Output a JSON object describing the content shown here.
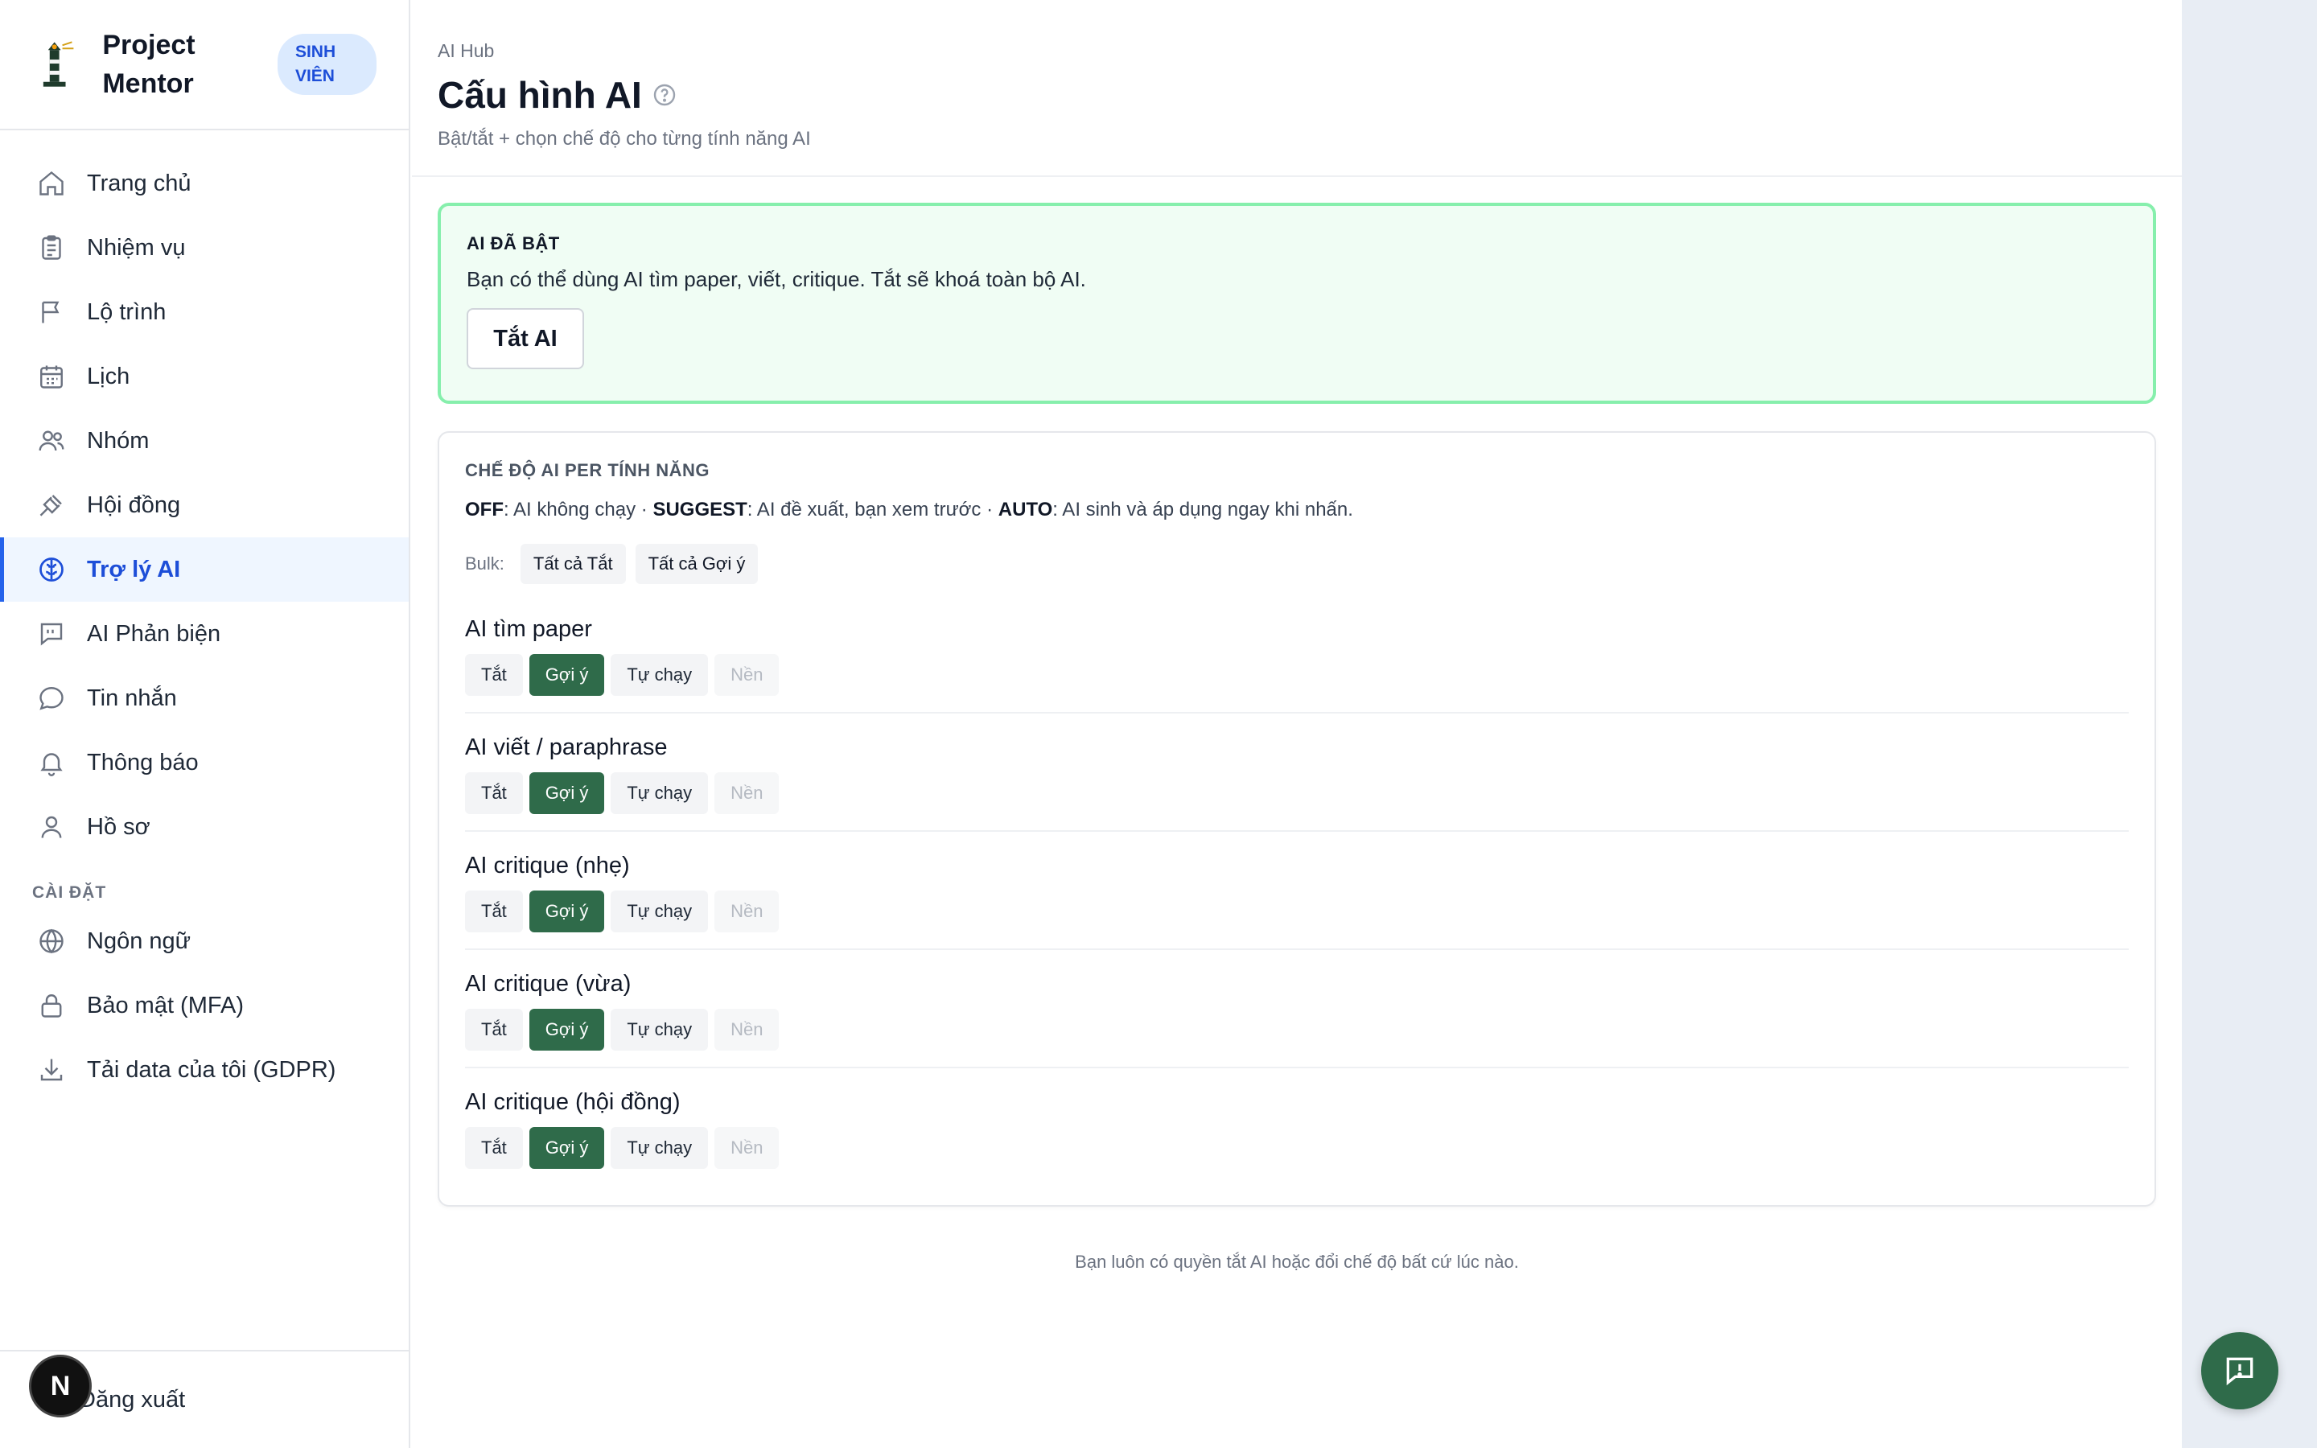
{
  "app": {
    "name": "Project Mentor",
    "role_badge": "SINH VIÊN"
  },
  "sidebar": {
    "items": [
      {
        "label": "Trang chủ",
        "icon": "home-icon"
      },
      {
        "label": "Nhiệm vụ",
        "icon": "clipboard-icon"
      },
      {
        "label": "Lộ trình",
        "icon": "flag-icon"
      },
      {
        "label": "Lịch",
        "icon": "calendar-icon"
      },
      {
        "label": "Nhóm",
        "icon": "users-icon"
      },
      {
        "label": "Hội đồng",
        "icon": "gavel-icon"
      },
      {
        "label": "Trợ lý AI",
        "icon": "brain-icon",
        "active": true
      },
      {
        "label": "AI Phản biện",
        "icon": "quote-message-icon"
      },
      {
        "label": "Tin nhắn",
        "icon": "chat-bubble-icon"
      },
      {
        "label": "Thông báo",
        "icon": "bell-icon"
      },
      {
        "label": "Hồ sơ",
        "icon": "user-icon"
      }
    ],
    "settings_label": "CÀI ĐẶT",
    "settings_items": [
      {
        "label": "Ngôn ngữ",
        "icon": "globe-icon"
      },
      {
        "label": "Bảo mật (MFA)",
        "icon": "lock-icon"
      },
      {
        "label": "Tải data của tôi (GDPR)",
        "icon": "download-icon"
      }
    ],
    "logout_label": "Đăng xuất",
    "avatar_initial": "N"
  },
  "header": {
    "breadcrumb": "AI Hub",
    "title": "Cấu hình AI",
    "subtitle": "Bật/tắt + chọn chế độ cho từng tính năng AI"
  },
  "status_card": {
    "heading": "AI ĐÃ BẬT",
    "text": "Bạn có thể dùng AI tìm paper, viết, critique. Tắt sẽ khoá toàn bộ AI.",
    "button": "Tắt AI"
  },
  "modes_card": {
    "heading": "CHẾ ĐỘ AI PER TÍNH NĂNG",
    "legend": {
      "off_key": "OFF",
      "off_desc": ": AI không chạy · ",
      "suggest_key": "SUGGEST",
      "suggest_desc": ": AI đề xuất, bạn xem trước · ",
      "auto_key": "AUTO",
      "auto_desc": ": AI sinh và áp dụng ngay khi nhấn."
    },
    "bulk_label": "Bulk:",
    "bulk_buttons": [
      "Tất cả Tắt",
      "Tất cả Gợi ý"
    ],
    "mode_labels": [
      "Tắt",
      "Gợi ý",
      "Tự chạy",
      "Nền"
    ],
    "features": [
      {
        "name": "AI tìm paper",
        "selected": "Gợi ý"
      },
      {
        "name": "AI viết / paraphrase",
        "selected": "Gợi ý"
      },
      {
        "name": "AI critique (nhẹ)",
        "selected": "Gợi ý"
      },
      {
        "name": "AI critique (vừa)",
        "selected": "Gợi ý"
      },
      {
        "name": "AI critique (hội đồng)",
        "selected": "Gợi ý"
      }
    ]
  },
  "footnote": "Bạn luôn có quyền tắt AI hoặc đổi chế độ bất cứ lúc nào.",
  "colors": {
    "accent": "#2f6b4a",
    "active_nav": "#1d4ed8",
    "status_border": "#86efac"
  }
}
